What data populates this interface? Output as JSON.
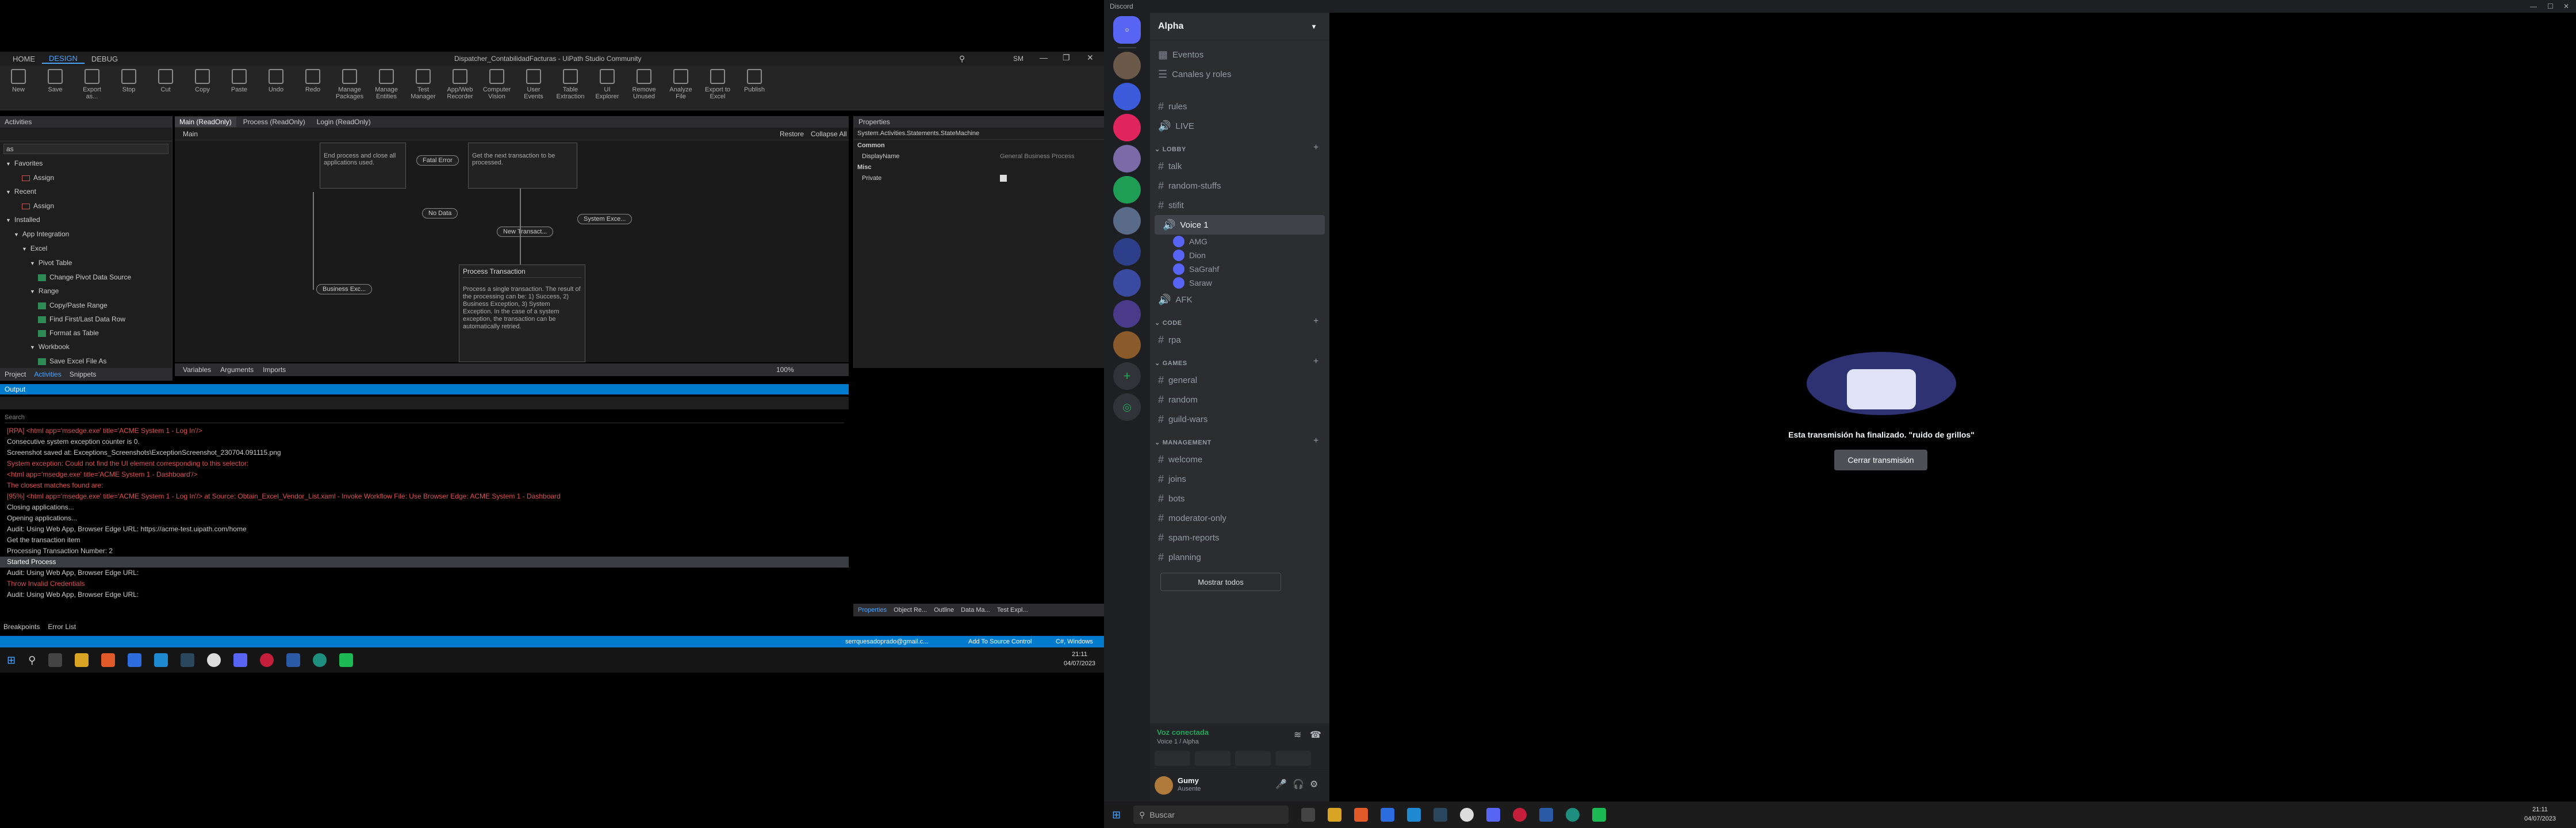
{
  "uipath": {
    "title": "Dispatcher_ContabilidadFacturas - UiPath Studio Community",
    "tabs": [
      "HOME",
      "DESIGN",
      "DEBUG"
    ],
    "user_initials": "SM",
    "ribbon": [
      {
        "label": "New"
      },
      {
        "label": "Save"
      },
      {
        "label": "Export as..."
      },
      {
        "label": "Stop"
      },
      {
        "label": "Cut"
      },
      {
        "label": "Copy"
      },
      {
        "label": "Paste"
      },
      {
        "label": "Undo"
      },
      {
        "label": "Redo"
      },
      {
        "label": "Manage Packages"
      },
      {
        "label": "Manage Entities"
      },
      {
        "label": "Test Manager"
      },
      {
        "label": "App/Web Recorder"
      },
      {
        "label": "Computer Vision"
      },
      {
        "label": "User Events"
      },
      {
        "label": "Table Extraction"
      },
      {
        "label": "UI Explorer"
      },
      {
        "label": "Remove Unused"
      },
      {
        "label": "Analyze File"
      },
      {
        "label": "Export to Excel"
      },
      {
        "label": "Publish"
      }
    ],
    "activities": {
      "title": "Activities",
      "search_value": "as",
      "tree": [
        {
          "label": "Favorites",
          "level": 0
        },
        {
          "label": "Assign",
          "level": 2,
          "icon": "assign"
        },
        {
          "label": "Recent",
          "level": 0
        },
        {
          "label": "Assign",
          "level": 2,
          "icon": "assign"
        },
        {
          "label": "Installed",
          "level": 0
        },
        {
          "label": "App Integration",
          "level": 1
        },
        {
          "label": "Excel",
          "level": 2
        },
        {
          "label": "Pivot Table",
          "level": 3
        },
        {
          "label": "Change Pivot Data Source",
          "level": 4,
          "icon": "excel"
        },
        {
          "label": "Range",
          "level": 3
        },
        {
          "label": "Copy/Paste Range",
          "level": 4,
          "icon": "excel"
        },
        {
          "label": "Find First/Last Data Row",
          "level": 4,
          "icon": "excel"
        },
        {
          "label": "Format as Table",
          "level": 4,
          "icon": "excel"
        },
        {
          "label": "Workbook",
          "level": 3
        },
        {
          "label": "Save Excel File As",
          "level": 4,
          "icon": "excel"
        }
      ],
      "bottom_tabs": [
        "Project",
        "Activities",
        "Snippets"
      ]
    },
    "designer": {
      "doc_tabs": [
        "Main (ReadOnly)",
        "Process (ReadOnly)",
        "Login (ReadOnly)"
      ],
      "breadcrumb": "Main",
      "expand": "Restore",
      "collapse": "Collapse All",
      "box1": "End process and close all applications used.",
      "box2": "Get the next transaction to be processed.",
      "pills": [
        "Fatal Error",
        "No Data",
        "New Transact...",
        "System Exce...",
        "Business Exc..."
      ],
      "process_title": "Process Transaction",
      "process_body": "Process a single transaction. The result of the processing can be: 1) Success, 2) Business Exception, 3) System Exception. In the case of a system exception, the transaction can be automatically retried.",
      "bottom_tabs": [
        "Variables",
        "Arguments",
        "Imports"
      ],
      "zoom": "100%"
    },
    "properties": {
      "title": "Properties",
      "type": "System.Activities.Statements.StateMachine",
      "sections": [
        "Common",
        "Misc"
      ],
      "rows": [
        {
          "name": "DisplayName",
          "value": "General Business Process"
        },
        {
          "name": "Private",
          "value": ""
        }
      ],
      "bottom_tabs": [
        "Properties",
        "Object Re...",
        "Outline",
        "Data Ma...",
        "Test Expl..."
      ]
    },
    "output": {
      "title": "Output",
      "search_placeholder": "Search",
      "lines": [
        {
          "text": "[RPA] <html app='msedge.exe' title='ACME System 1 - Log In'/>",
          "level": "error"
        },
        {
          "text": "Consecutive system exception counter is 0.",
          "level": "info"
        },
        {
          "text": "Screenshot saved at: Exceptions_Screenshots\\ExceptionScreenshot_230704.091115.png",
          "level": "info"
        },
        {
          "text": "System exception: Could not find the UI element corresponding to this selector:",
          "level": "error"
        },
        {
          "text": "<html app='msedge.exe' title='ACME System 1 - Dashboard'/>",
          "level": "error"
        },
        {
          "text": "",
          "level": "info"
        },
        {
          "text": "The closest matches found are:",
          "level": "error"
        },
        {
          "text": "[95%] <html app='msedge.exe' title='ACME System 1 - Log In'/> at Source: Obtain_Excel_Vendor_List.xaml - Invoke Workflow File: Use Browser Edge: ACME System 1 - Dashboard",
          "level": "error"
        },
        {
          "text": "Closing applications...",
          "level": "info"
        },
        {
          "text": "Opening applications...",
          "level": "info"
        },
        {
          "text": "Audit: Using Web App, Browser Edge URL: https://acme-test.uipath.com/home",
          "level": "info"
        },
        {
          "text": "Get the transaction item",
          "level": "info"
        },
        {
          "text": "Processing Transaction Number: 2",
          "level": "info"
        },
        {
          "text": "Started Process",
          "level": "info"
        },
        {
          "text": "Audit: Using Web App, Browser Edge URL:",
          "level": "info"
        },
        {
          "text": "Throw Invalid Credentials",
          "level": "error"
        },
        {
          "text": "Audit: Using Web App, Browser Edge URL:",
          "level": "info"
        }
      ],
      "bottom_tabs": [
        "Breakpoints",
        "Error List"
      ]
    },
    "status": {
      "account": "serrquesadoprado@gmail.c...",
      "source_control": "Add To Source Control",
      "project": "C#, Windows"
    },
    "taskbar_clock": {
      "time": "21:11",
      "date": "04/07/2023"
    }
  },
  "discord": {
    "app_title": "Discord",
    "server_name": "Alpha",
    "top_items": [
      {
        "label": "Eventos",
        "icon": "calendar-icon"
      },
      {
        "label": "Canales y roles",
        "icon": "list-icon"
      }
    ],
    "channels_top": [
      {
        "label": "rules",
        "type": "text"
      },
      {
        "label": "LIVE",
        "type": "voice"
      }
    ],
    "categories": [
      {
        "name": "LOBBY",
        "channels": [
          {
            "label": "talk",
            "type": "text"
          },
          {
            "label": "random-stuffs",
            "type": "text"
          },
          {
            "label": "stifit",
            "type": "text"
          },
          {
            "label": "Voice 1",
            "type": "voice",
            "active": true
          }
        ]
      },
      {
        "name": "CODE",
        "channels": [
          {
            "label": "rpa",
            "type": "text"
          }
        ]
      },
      {
        "name": "GAMES",
        "channels": [
          {
            "label": "general",
            "type": "text"
          },
          {
            "label": "random",
            "type": "text"
          },
          {
            "label": "guild-wars",
            "type": "text"
          }
        ]
      },
      {
        "name": "MANAGEMENT",
        "channels": [
          {
            "label": "welcome",
            "type": "text"
          },
          {
            "label": "joins",
            "type": "text"
          },
          {
            "label": "bots",
            "type": "text"
          },
          {
            "label": "moderator-only",
            "type": "text"
          },
          {
            "label": "spam-reports",
            "type": "text"
          },
          {
            "label": "planning",
            "type": "text"
          }
        ]
      }
    ],
    "voice_users": [
      "AMG",
      "Dion",
      "SaGrahf",
      "Saraw"
    ],
    "afk": "AFK",
    "show_all": "Mostrar todos",
    "voice_status": "Voz conectada",
    "voice_channel": "Voice 1 / Alpha",
    "user": {
      "name": "Gumy",
      "status": "Ausente"
    },
    "stream_ended": "Esta transmisión ha finalizado. \"ruido de grillos\"",
    "close_stream": "Cerrar transmisión",
    "search_placeholder": "Buscar",
    "clock": {
      "time": "21:11",
      "date": "04/07/2023"
    },
    "colors": {
      "accent": "#5865f2",
      "green": "#23a55a",
      "bg": "#313338"
    }
  }
}
